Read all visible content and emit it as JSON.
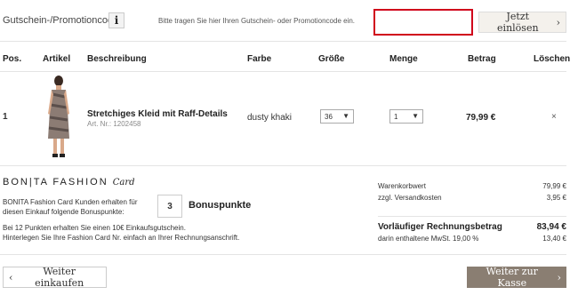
{
  "promo": {
    "label": "Gutschein-/Promotioncode",
    "info_glyph": "i",
    "hint": "Bitte tragen Sie hier Ihren Gutschein- oder Promotioncode ein.",
    "input_value": "",
    "redeem_label": "Jetzt einlösen"
  },
  "table": {
    "headers": {
      "pos": "Pos.",
      "artikel": "Artikel",
      "beschreibung": "Beschreibung",
      "farbe": "Farbe",
      "groesse": "Größe",
      "menge": "Menge",
      "betrag": "Betrag",
      "loeschen": "Löschen"
    },
    "rows": [
      {
        "pos": "1",
        "title": "Stretchiges Kleid mit Raff-Details",
        "article_no": "Art. Nr.: 1202458",
        "color": "dusty khaki",
        "size": "36",
        "quantity": "1",
        "amount": "79,99 €",
        "delete_glyph": "×"
      }
    ]
  },
  "fashion_card": {
    "logo_main": "BON|TA FASHION",
    "logo_script": "Card",
    "desc_line1": "BONITA Fashion Card Kunden erhalten für",
    "desc_line2": "diesen Einkauf folgende Bonuspunkte:",
    "points": "3",
    "points_label": "Bonuspunkte",
    "info_line1": "Bei 12 Punkten erhalten Sie einen 10€ Einkaufsgutschein.",
    "info_line2": "Hinterlegen Sie Ihre Fashion Card Nr. einfach an Ihrer Rechnungsanschrift."
  },
  "summary": {
    "goods_label": "Warenkorbwert",
    "goods_value": "79,99 €",
    "shipping_label": "zzgl. Versandkosten",
    "shipping_value": "3,95 €",
    "total_label": "Vorläufiger Rechnungsbetrag",
    "total_value": "83,94 €",
    "vat_label": "darin enthaltene MwSt. 19,00 %",
    "vat_value": "13,40 €"
  },
  "nav": {
    "back_label": "Weiter einkaufen",
    "checkout_label": "Weiter zur Kasse"
  },
  "icons": {
    "chevron_right": "›",
    "chevron_left": "‹",
    "dropdown": "▼"
  },
  "colors": {
    "accent_red": "#d0021b",
    "checkout_bg": "#8a7e72",
    "redeem_bg": "#f4f1ec"
  }
}
